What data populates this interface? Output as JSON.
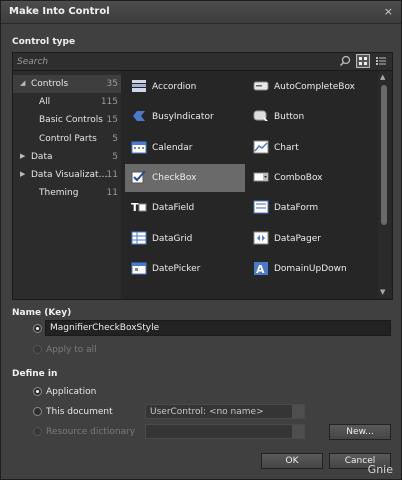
{
  "dialog": {
    "title": "Make Into Control",
    "close_glyph": "×"
  },
  "control_type": {
    "heading": "Control type",
    "search_placeholder": "Search",
    "tree": [
      {
        "label": "Controls",
        "count": "35",
        "arrow": "◢",
        "indent": 0
      },
      {
        "label": "All",
        "count": "115",
        "arrow": "",
        "indent": 1
      },
      {
        "label": "Basic Controls",
        "count": "15",
        "arrow": "",
        "indent": 1
      },
      {
        "label": "Control Parts",
        "count": "5",
        "arrow": "",
        "indent": 1
      },
      {
        "label": "Data",
        "count": "5",
        "arrow": "▶",
        "indent": 0
      },
      {
        "label": "Data Visualizat…",
        "count": "11",
        "arrow": "▶",
        "indent": 0
      },
      {
        "label": "Theming",
        "count": "11",
        "arrow": "",
        "indent": 1
      }
    ],
    "controls": [
      {
        "label": "Accordion",
        "icon": "accordion-icon",
        "selected": false
      },
      {
        "label": "AutoCompleteBox",
        "icon": "autocompletebox-icon",
        "selected": false
      },
      {
        "label": "BusyIndicator",
        "icon": "busyindicator-icon",
        "selected": false
      },
      {
        "label": "Button",
        "icon": "button-icon",
        "selected": false
      },
      {
        "label": "Calendar",
        "icon": "calendar-icon",
        "selected": false
      },
      {
        "label": "Chart",
        "icon": "chart-icon",
        "selected": false
      },
      {
        "label": "CheckBox",
        "icon": "checkbox-icon",
        "selected": true
      },
      {
        "label": "ComboBox",
        "icon": "combobox-icon",
        "selected": false
      },
      {
        "label": "DataField",
        "icon": "datafield-icon",
        "selected": false
      },
      {
        "label": "DataForm",
        "icon": "dataform-icon",
        "selected": false
      },
      {
        "label": "DataGrid",
        "icon": "datagrid-icon",
        "selected": false
      },
      {
        "label": "DataPager",
        "icon": "datapager-icon",
        "selected": false
      },
      {
        "label": "DatePicker",
        "icon": "datepicker-icon",
        "selected": false
      },
      {
        "label": "DomainUpDown",
        "icon": "domainupdown-icon",
        "selected": false
      },
      {
        "label": "",
        "icon": "partial-icon",
        "selected": false
      },
      {
        "label": "",
        "icon": "partial-icon",
        "selected": false
      }
    ]
  },
  "name_key": {
    "heading": "Name (Key)",
    "value": "MagnifierCheckBoxStyle",
    "apply_to_all": "Apply to all"
  },
  "define_in": {
    "heading": "Define in",
    "application": "Application",
    "this_document": "This document",
    "document_combo": "UserControl: <no name>",
    "resource_dictionary": "Resource dictionary",
    "new_button": "New..."
  },
  "buttons": {
    "ok": "OK",
    "cancel": "Cancel"
  },
  "watermark": "Gnie",
  "colors": {
    "background": "#404040",
    "panel": "#262626",
    "selected": "#6a6a6a"
  }
}
